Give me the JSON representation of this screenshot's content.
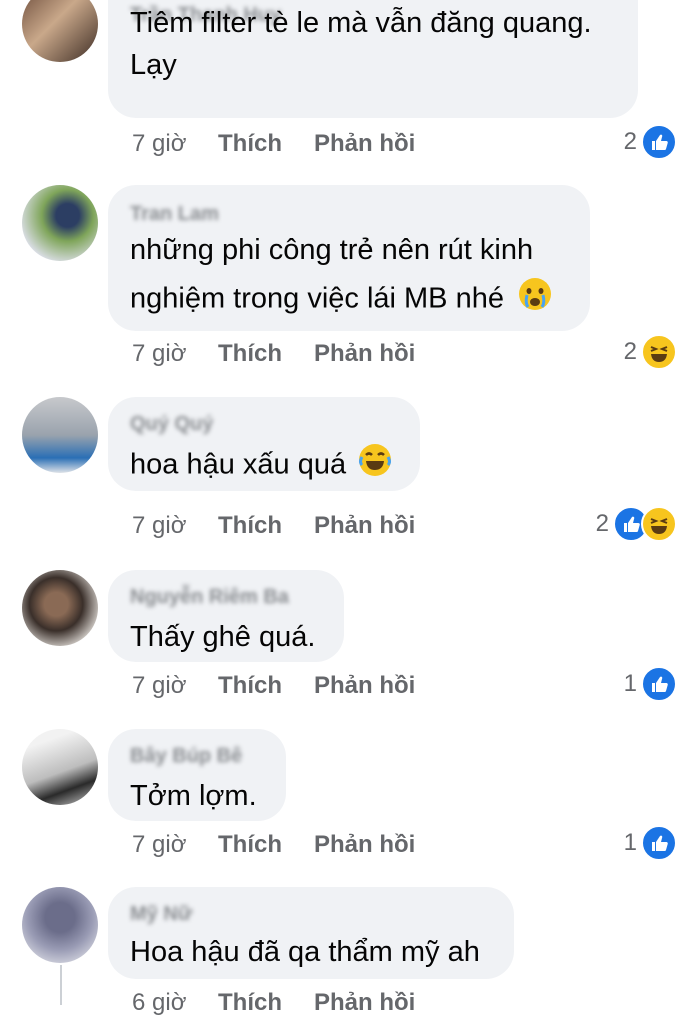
{
  "comments": [
    {
      "author": "Trần Thanh Huy",
      "lines": [
        "Tiêm filter tè le mà vẫn đăng quang.",
        "Lạy"
      ],
      "time": "7 giờ",
      "like_label": "Thích",
      "reply_label": "Phản hồi",
      "reaction_count": "2",
      "reactions": [
        "like-icon"
      ]
    },
    {
      "author": "Tran Lam",
      "lines": [
        "những phi công trẻ nên rút kinh",
        "nghiệm trong việc lái MB nhé"
      ],
      "emoji": "crying-face-icon",
      "time": "7 giờ",
      "like_label": "Thích",
      "reply_label": "Phản hồi",
      "reaction_count": "2",
      "reactions": [
        "haha-icon"
      ]
    },
    {
      "author": "Quý Quý",
      "lines": [
        "hoa hậu xấu quá"
      ],
      "emoji": "laughing-tears-icon",
      "time": "7 giờ",
      "like_label": "Thích",
      "reply_label": "Phản hồi",
      "reaction_count": "2",
      "reactions": [
        "like-icon",
        "haha-icon"
      ]
    },
    {
      "author": "Nguyễn Riêm Ba",
      "lines": [
        "Thấy ghê quá."
      ],
      "time": "7 giờ",
      "like_label": "Thích",
      "reply_label": "Phản hồi",
      "reaction_count": "1",
      "reactions": [
        "like-icon"
      ]
    },
    {
      "author": "Bây Búp Bê",
      "lines": [
        "Tởm lợm."
      ],
      "time": "7 giờ",
      "like_label": "Thích",
      "reply_label": "Phản hồi",
      "reaction_count": "1",
      "reactions": [
        "like-icon"
      ]
    },
    {
      "author": "Mỹ Nữ",
      "lines": [
        "Hoa hậu đã qa thẩm mỹ ah"
      ],
      "time": "6 giờ",
      "like_label": "Thích",
      "reply_label": "Phản hồi"
    }
  ],
  "colors": {
    "bubble": "#f0f2f5",
    "meta_text": "#65676b",
    "like_blue": "#1b74e4",
    "haha_yellow": "#f7c51e"
  }
}
